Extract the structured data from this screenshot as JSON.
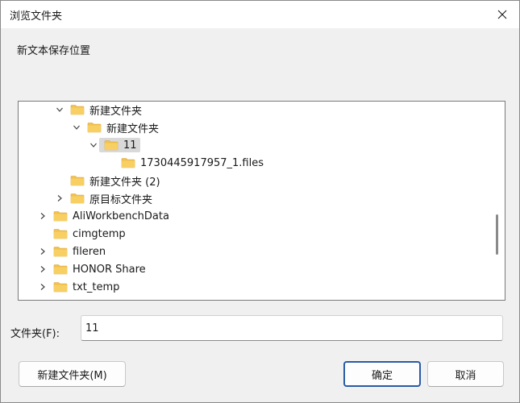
{
  "window": {
    "title": "浏览文件夹"
  },
  "description": "新文本保存位置",
  "tree": {
    "items": [
      {
        "label": "新建文件夹",
        "expanded": true,
        "has_children": true,
        "depth": 1,
        "selected": false
      },
      {
        "label": "新建文件夹",
        "expanded": true,
        "has_children": true,
        "depth": 2,
        "selected": false
      },
      {
        "label": "11",
        "expanded": true,
        "has_children": true,
        "depth": 3,
        "selected": true
      },
      {
        "label": "1730445917957_1.files",
        "expanded": false,
        "has_children": false,
        "depth": 4,
        "selected": false
      },
      {
        "label": "新建文件夹 (2)",
        "expanded": false,
        "has_children": false,
        "depth": 1,
        "selected": false
      },
      {
        "label": "原目标文件夹",
        "expanded": false,
        "has_children": true,
        "depth": 1,
        "selected": false
      },
      {
        "label": "AliWorkbenchData",
        "expanded": false,
        "has_children": true,
        "depth": 0,
        "selected": false
      },
      {
        "label": "cimgtemp",
        "expanded": false,
        "has_children": false,
        "depth": 0,
        "selected": false
      },
      {
        "label": "fileren",
        "expanded": false,
        "has_children": true,
        "depth": 0,
        "selected": false
      },
      {
        "label": "HONOR Share",
        "expanded": false,
        "has_children": true,
        "depth": 0,
        "selected": false
      },
      {
        "label": "txt_temp",
        "expanded": false,
        "has_children": true,
        "depth": 0,
        "selected": false
      }
    ]
  },
  "folder_field": {
    "label": "文件夹(F):",
    "value": "11"
  },
  "buttons": {
    "new_folder": "新建文件夹(M)",
    "ok": "确定",
    "cancel": "取消"
  },
  "colors": {
    "folder": "#f2c14e",
    "selection": "#d9d9d9",
    "ok_border": "#2a5aa8"
  }
}
